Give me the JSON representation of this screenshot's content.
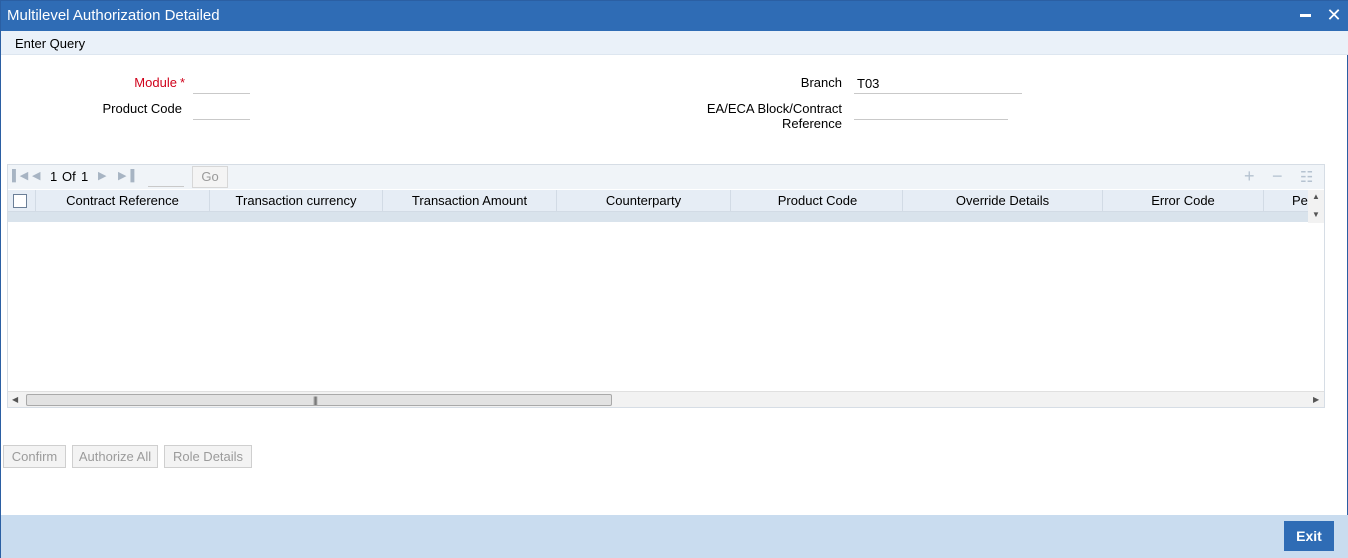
{
  "window": {
    "title": "Multilevel Authorization Detailed",
    "minimize_icon": "minimize-icon",
    "close_icon": "close-icon",
    "close_glyph": "✕"
  },
  "toolbar": {
    "enter_query": "Enter Query"
  },
  "form": {
    "module_label": "Module",
    "required_marker": "*",
    "module_value": "",
    "product_code_label": "Product Code",
    "product_code_value": "",
    "branch_label": "Branch",
    "branch_value": "T03",
    "ea_label_line1": "EA/ECA Block/Contract",
    "ea_label_line2": "Reference",
    "ea_value": ""
  },
  "grid": {
    "pager": {
      "current": "1",
      "of_label": "Of",
      "total": "1",
      "page_input": "",
      "go_label": "Go"
    },
    "columns": [
      "Contract Reference",
      "Transaction currency",
      "Transaction Amount",
      "Counterparty",
      "Product Code",
      "Override Details",
      "Error Code",
      "Pe"
    ],
    "rows": []
  },
  "actions": {
    "confirm": "Confirm",
    "authorize_all": "Authorize All",
    "role_details": "Role Details"
  },
  "footer": {
    "exit": "Exit"
  },
  "colors": {
    "title_bar": "#2f6cb5",
    "footer": "#c9dcef",
    "required": "#d0021b"
  }
}
